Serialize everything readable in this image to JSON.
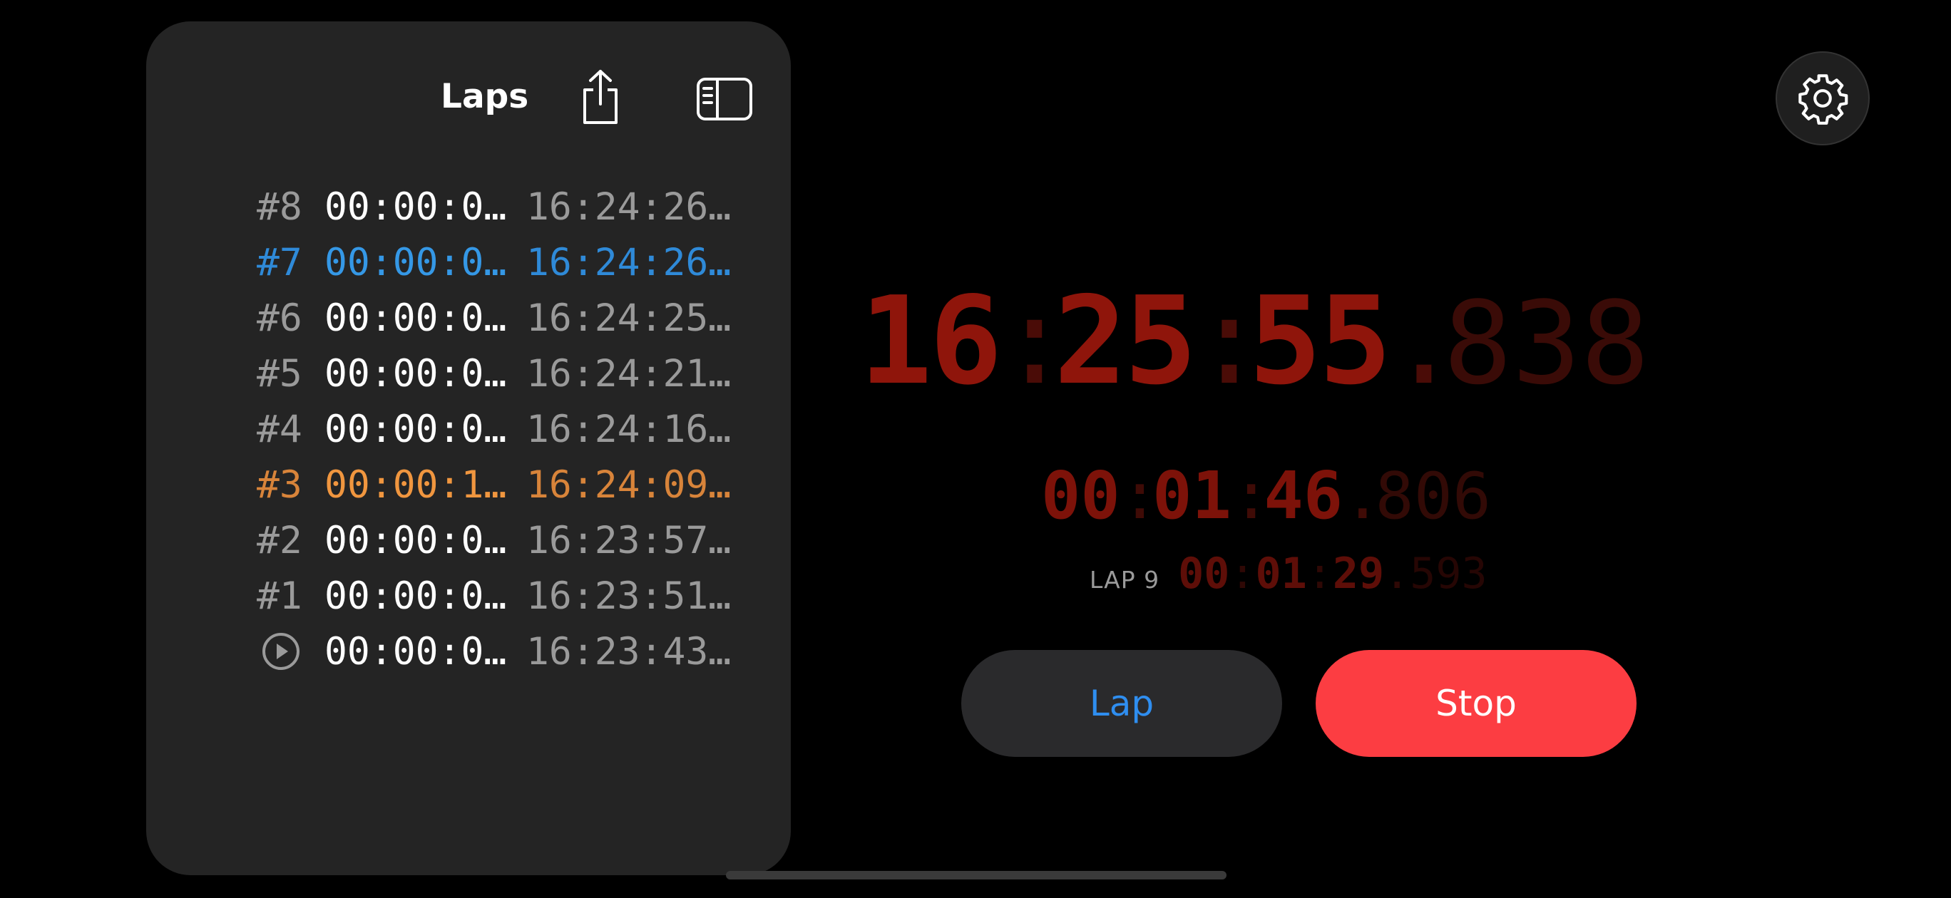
{
  "laps_panel": {
    "title": "Laps",
    "laps": [
      {
        "number": "#8",
        "duration": "00:00:0…",
        "time": "16:24:26…",
        "highlight": "none"
      },
      {
        "number": "#7",
        "duration": "00:00:0…",
        "time": "16:24:26…",
        "highlight": "blue"
      },
      {
        "number": "#6",
        "duration": "00:00:0…",
        "time": "16:24:25…",
        "highlight": "none"
      },
      {
        "number": "#5",
        "duration": "00:00:0…",
        "time": "16:24:21…",
        "highlight": "none"
      },
      {
        "number": "#4",
        "duration": "00:00:0…",
        "time": "16:24:16…",
        "highlight": "none"
      },
      {
        "number": "#3",
        "duration": "00:00:1…",
        "time": "16:24:09…",
        "highlight": "orange"
      },
      {
        "number": "#2",
        "duration": "00:00:0…",
        "time": "16:23:57…",
        "highlight": "none"
      },
      {
        "number": "#1",
        "duration": "00:00:0…",
        "time": "16:23:51…",
        "highlight": "none"
      },
      {
        "number": "",
        "duration": "00:00:0…",
        "time": "16:23:43…",
        "highlight": "start"
      }
    ]
  },
  "clock": {
    "h": "16",
    "m": "25",
    "s": "55",
    "ms": "838"
  },
  "total": {
    "h": "00",
    "m": "01",
    "s": "46",
    "ms": "806"
  },
  "current_lap": {
    "label": "LAP 9",
    "h": "00",
    "m": "01",
    "s": "29",
    "ms": "593"
  },
  "buttons": {
    "lap": "Lap",
    "stop": "Stop"
  },
  "icons": {
    "share": "share-icon",
    "sidebar": "sidebar-icon",
    "settings": "gear-icon",
    "start": "play-circle-icon"
  },
  "colors": {
    "accent_blue": "#2f8ef0",
    "stop_red": "#fc3d42",
    "clock_red": "#8f150b",
    "highlight_orange": "#f0963f"
  }
}
